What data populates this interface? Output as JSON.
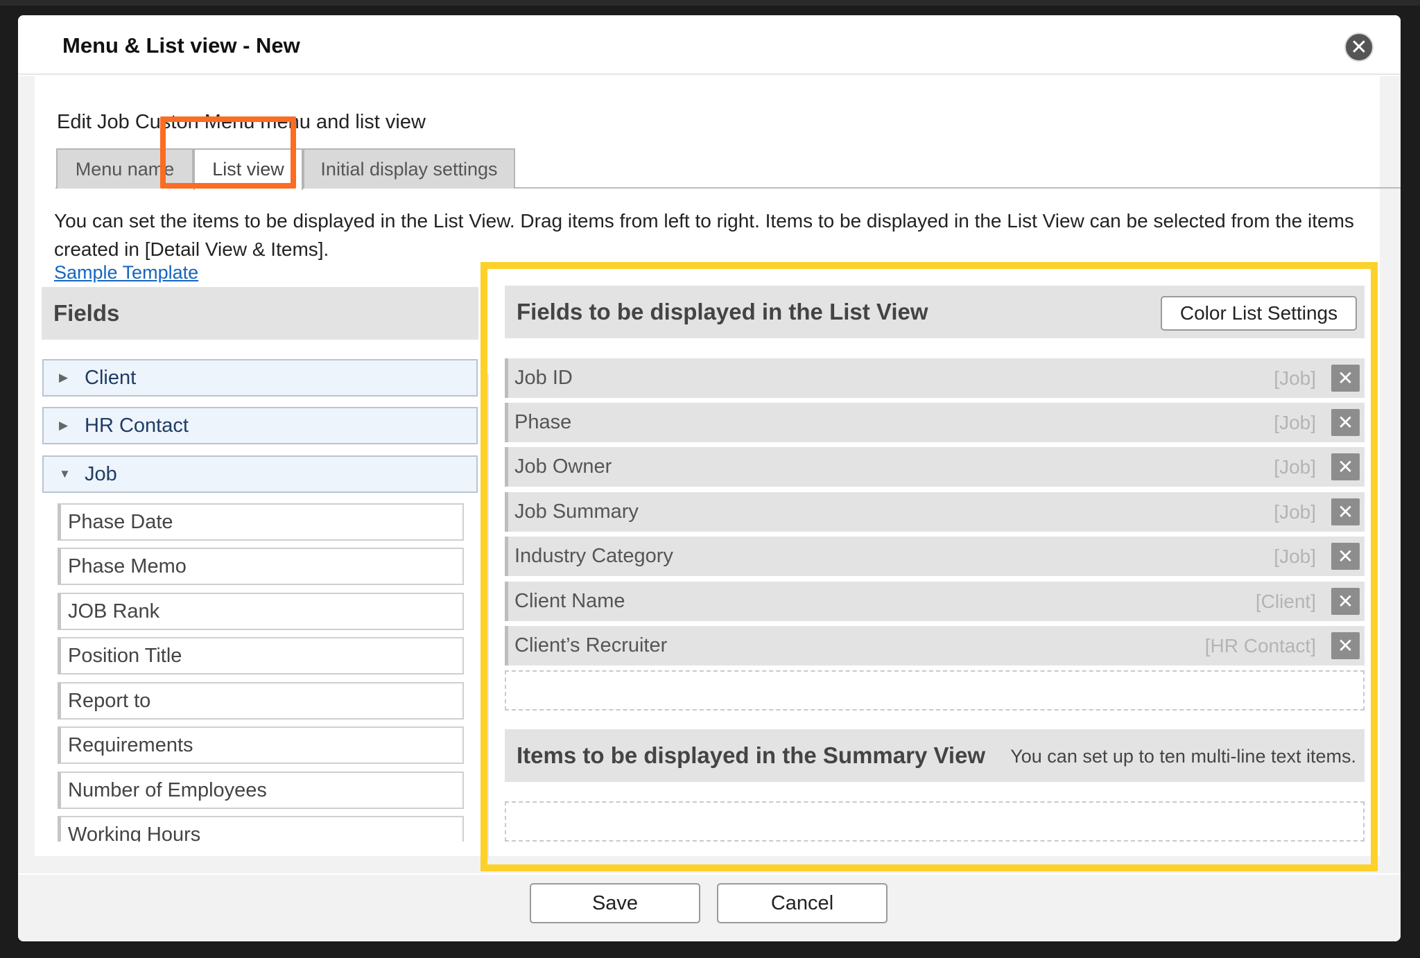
{
  "modal": {
    "title": "Menu & List view - New",
    "close_symbol": "✕",
    "subtitle": "Edit Job Custon Menu menu and list view"
  },
  "tabs": [
    {
      "label": "Menu name",
      "active": false
    },
    {
      "label": "List view",
      "active": true
    },
    {
      "label": "Initial display settings",
      "active": false
    }
  ],
  "description": "You can set the items to be displayed in the List View. Drag items from left to right. Items to be displayed in the List View can be selected from the items created in [Detail View & Items].",
  "sample_link": "Sample Template",
  "fields_panel": {
    "heading": "Fields",
    "groups": [
      {
        "label": "Client",
        "expanded": false,
        "caret": "▶"
      },
      {
        "label": "HR Contact",
        "expanded": false,
        "caret": "▶"
      },
      {
        "label": "Job",
        "expanded": true,
        "caret": "▼"
      }
    ],
    "job_fields": [
      "Phase Date",
      "Phase Memo",
      "JOB Rank",
      "Position Title",
      "Report to",
      "Requirements",
      "Number of Employees",
      "Working Hours"
    ]
  },
  "list_view": {
    "heading": "Fields to be displayed in the List View",
    "color_button": "Color List Settings",
    "remove_symbol": "✕",
    "selected": [
      {
        "label": "Job ID",
        "category": "[Job]"
      },
      {
        "label": "Phase",
        "category": "[Job]"
      },
      {
        "label": "Job Owner",
        "category": "[Job]"
      },
      {
        "label": "Job Summary",
        "category": "[Job]"
      },
      {
        "label": "Industry Category",
        "category": "[Job]"
      },
      {
        "label": "Client Name",
        "category": "[Client]"
      },
      {
        "label": "Client’s Recruiter",
        "category": "[HR Contact]"
      }
    ]
  },
  "summary_view": {
    "heading": "Items to be displayed in the Summary View",
    "note": "You can set up to ten multi-line text items."
  },
  "footer": {
    "save_label": "Save",
    "cancel_label": "Cancel"
  },
  "colors": {
    "highlight_orange": "#fc6c22",
    "highlight_yellow": "#fcd12a",
    "link_blue": "#1565c0"
  }
}
